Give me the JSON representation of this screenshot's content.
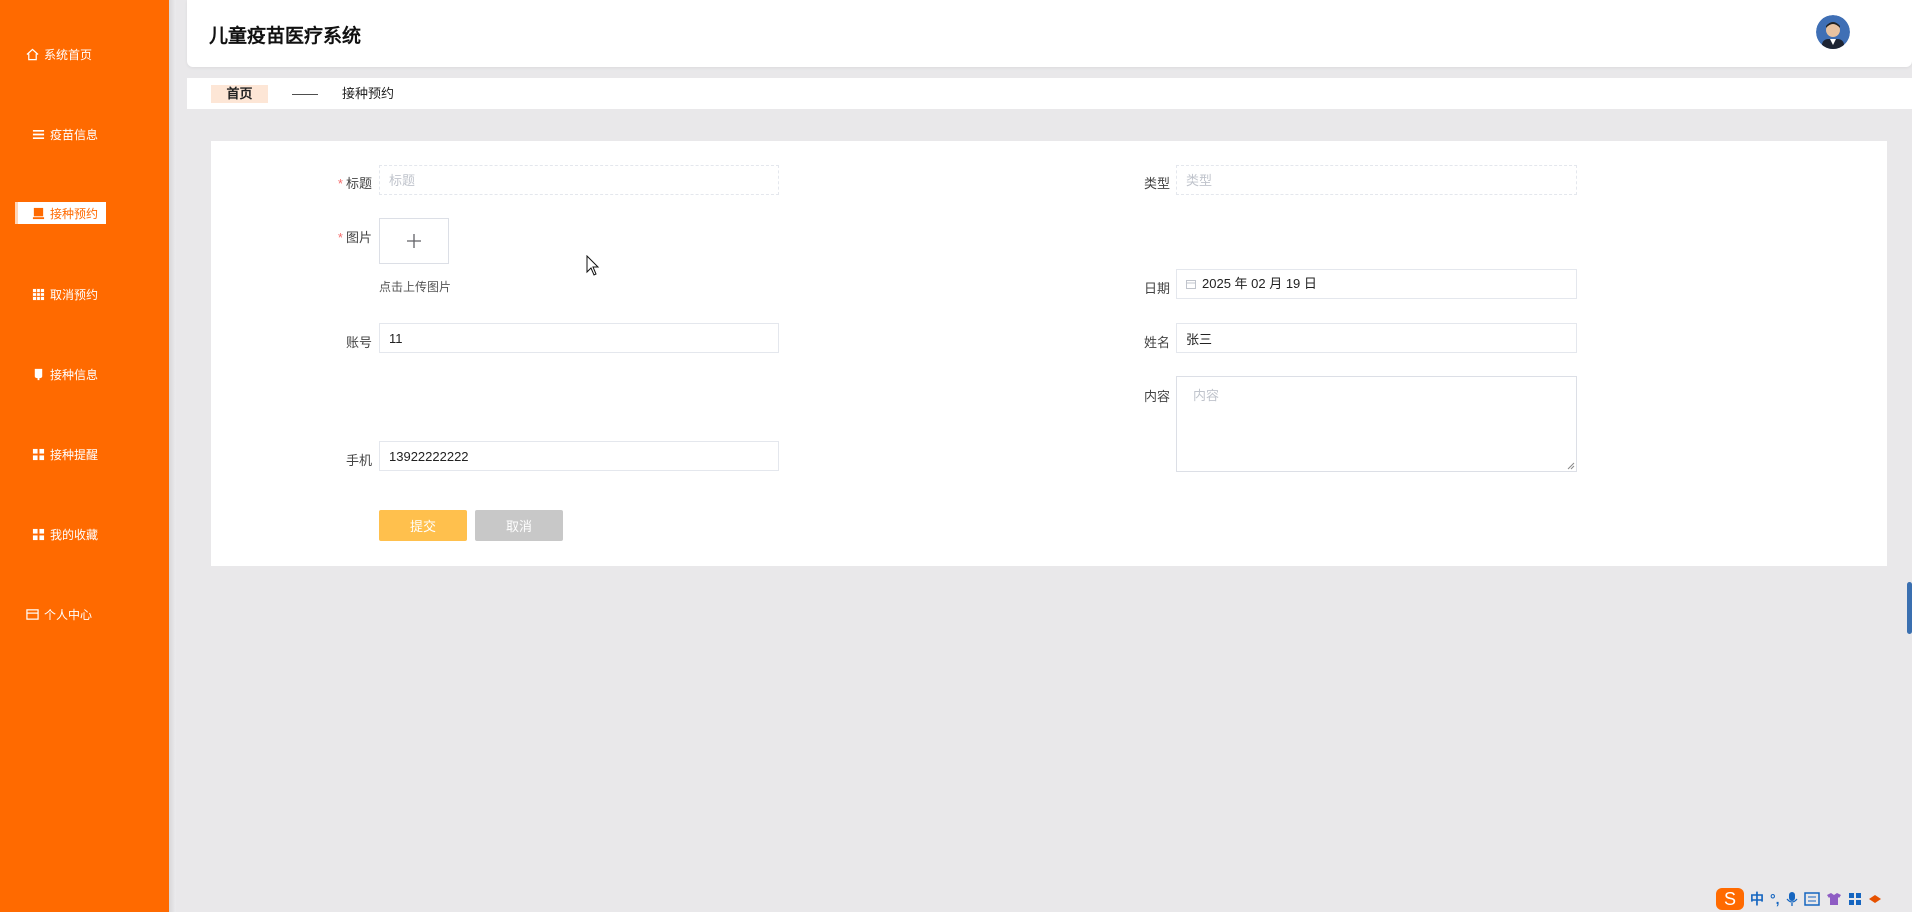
{
  "header": {
    "title": "儿童疫苗医疗系统"
  },
  "sidebar": {
    "items": [
      {
        "label": "系统首页",
        "icon": "home-icon",
        "active": false
      },
      {
        "label": "疫苗信息",
        "icon": "list-icon",
        "active": false
      },
      {
        "label": "接种预约",
        "icon": "booking-icon",
        "active": true
      },
      {
        "label": "取消预约",
        "icon": "grid-icon",
        "active": false
      },
      {
        "label": "接种信息",
        "icon": "bookmark-icon",
        "active": false
      },
      {
        "label": "接种提醒",
        "icon": "apps-icon",
        "active": false
      },
      {
        "label": "我的收藏",
        "icon": "apps-icon",
        "active": false
      },
      {
        "label": "个人中心",
        "icon": "card-icon",
        "active": false
      }
    ]
  },
  "breadcrumb": {
    "home": "首页",
    "separator": "——",
    "current": "接种预约"
  },
  "form": {
    "title": {
      "label": "标题",
      "placeholder": "标题",
      "value": ""
    },
    "type": {
      "label": "类型",
      "placeholder": "类型",
      "value": ""
    },
    "image": {
      "label": "图片",
      "upload_hint": "点击上传图片"
    },
    "date": {
      "label": "日期",
      "value": "2025 年 02 月 19 日"
    },
    "account": {
      "label": "账号",
      "value": "11"
    },
    "name": {
      "label": "姓名",
      "value": "张三"
    },
    "content": {
      "label": "内容",
      "placeholder": "内容"
    },
    "phone": {
      "label": "手机",
      "value": "13922222222"
    },
    "submit_label": "提交",
    "cancel_label": "取消"
  },
  "tray": {
    "ime_logo": "S",
    "ime_mode": "中",
    "punct": "°,"
  },
  "colors": {
    "sidebar_bg": "#ff6a00",
    "submit_bg": "#ffc04d",
    "cancel_bg": "#c8c8c8",
    "required": "#f56c6c"
  }
}
